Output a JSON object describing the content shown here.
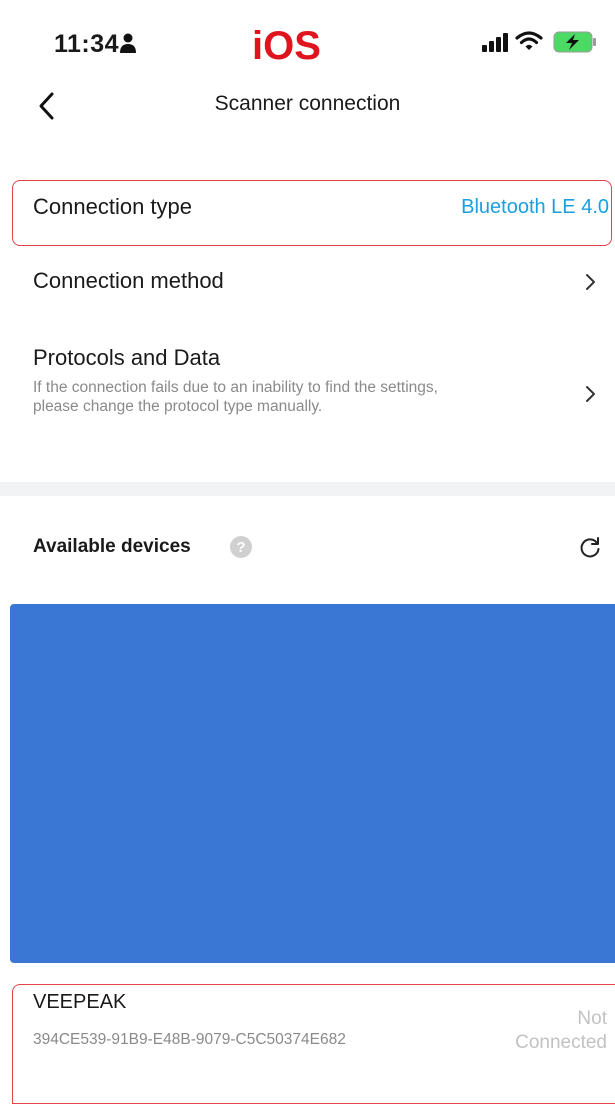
{
  "status_bar": {
    "time": "11:34",
    "os_label": "iOS"
  },
  "nav": {
    "title": "Scanner connection"
  },
  "rows": {
    "connection_type": {
      "label": "Connection type",
      "value": "Bluetooth LE 4.0"
    },
    "connection_method": {
      "label": "Connection method"
    },
    "protocols": {
      "label": "Protocols and Data",
      "description": "If the connection fails due to an inability to find the settings, please change the protocol type manually."
    }
  },
  "devices_section": {
    "title": "Available devices"
  },
  "devices": [
    {
      "name": "VEEPEAK",
      "id": "394CE539-91B9-E48B-9079-C5C50374E682",
      "status": "Not Connected"
    }
  ],
  "colors": {
    "accent": "#1a9fe0",
    "highlight_border": "#e0454a",
    "blue_block": "#3a76d4",
    "ios_label": "#e0141e"
  },
  "icons": [
    "person-icon",
    "signal-icon",
    "wifi-icon",
    "battery-charging-icon",
    "back-chevron-icon",
    "chevron-right-icon",
    "help-icon",
    "refresh-icon"
  ]
}
